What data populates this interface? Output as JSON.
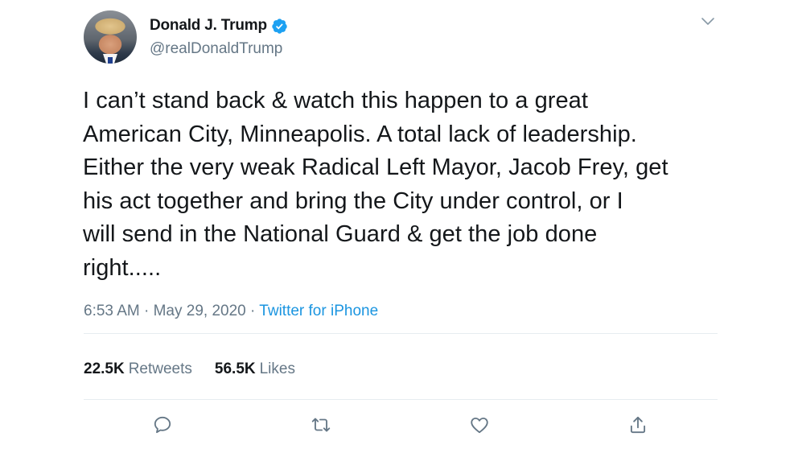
{
  "author": {
    "display_name": "Donald J. Trump",
    "handle": "@realDonaldTrump",
    "verified": true,
    "avatar_icon": "profile-photo"
  },
  "tweet": {
    "lines": [
      "I can’t stand back & watch this happen to a great",
      "American City, Minneapolis. A total lack of leadership.",
      "Either the very weak Radical Left Mayor, Jacob Frey, get",
      "his act together and bring the City under control, or I",
      "will send in the National Guard & get the job done",
      "right....."
    ],
    "time": "6:53 AM",
    "separator": "·",
    "date": "May 29, 2020",
    "source": "Twitter for iPhone"
  },
  "stats": {
    "retweets_count": "22.5K",
    "retweets_label": "Retweets",
    "likes_count": "56.5K",
    "likes_label": "Likes"
  },
  "actions": [
    "reply-icon",
    "retweet-icon",
    "like-icon",
    "share-icon"
  ],
  "colors": {
    "text": "#14171a",
    "secondary": "#657786",
    "accent": "#1b95e0",
    "divider": "#e6ecf0"
  }
}
